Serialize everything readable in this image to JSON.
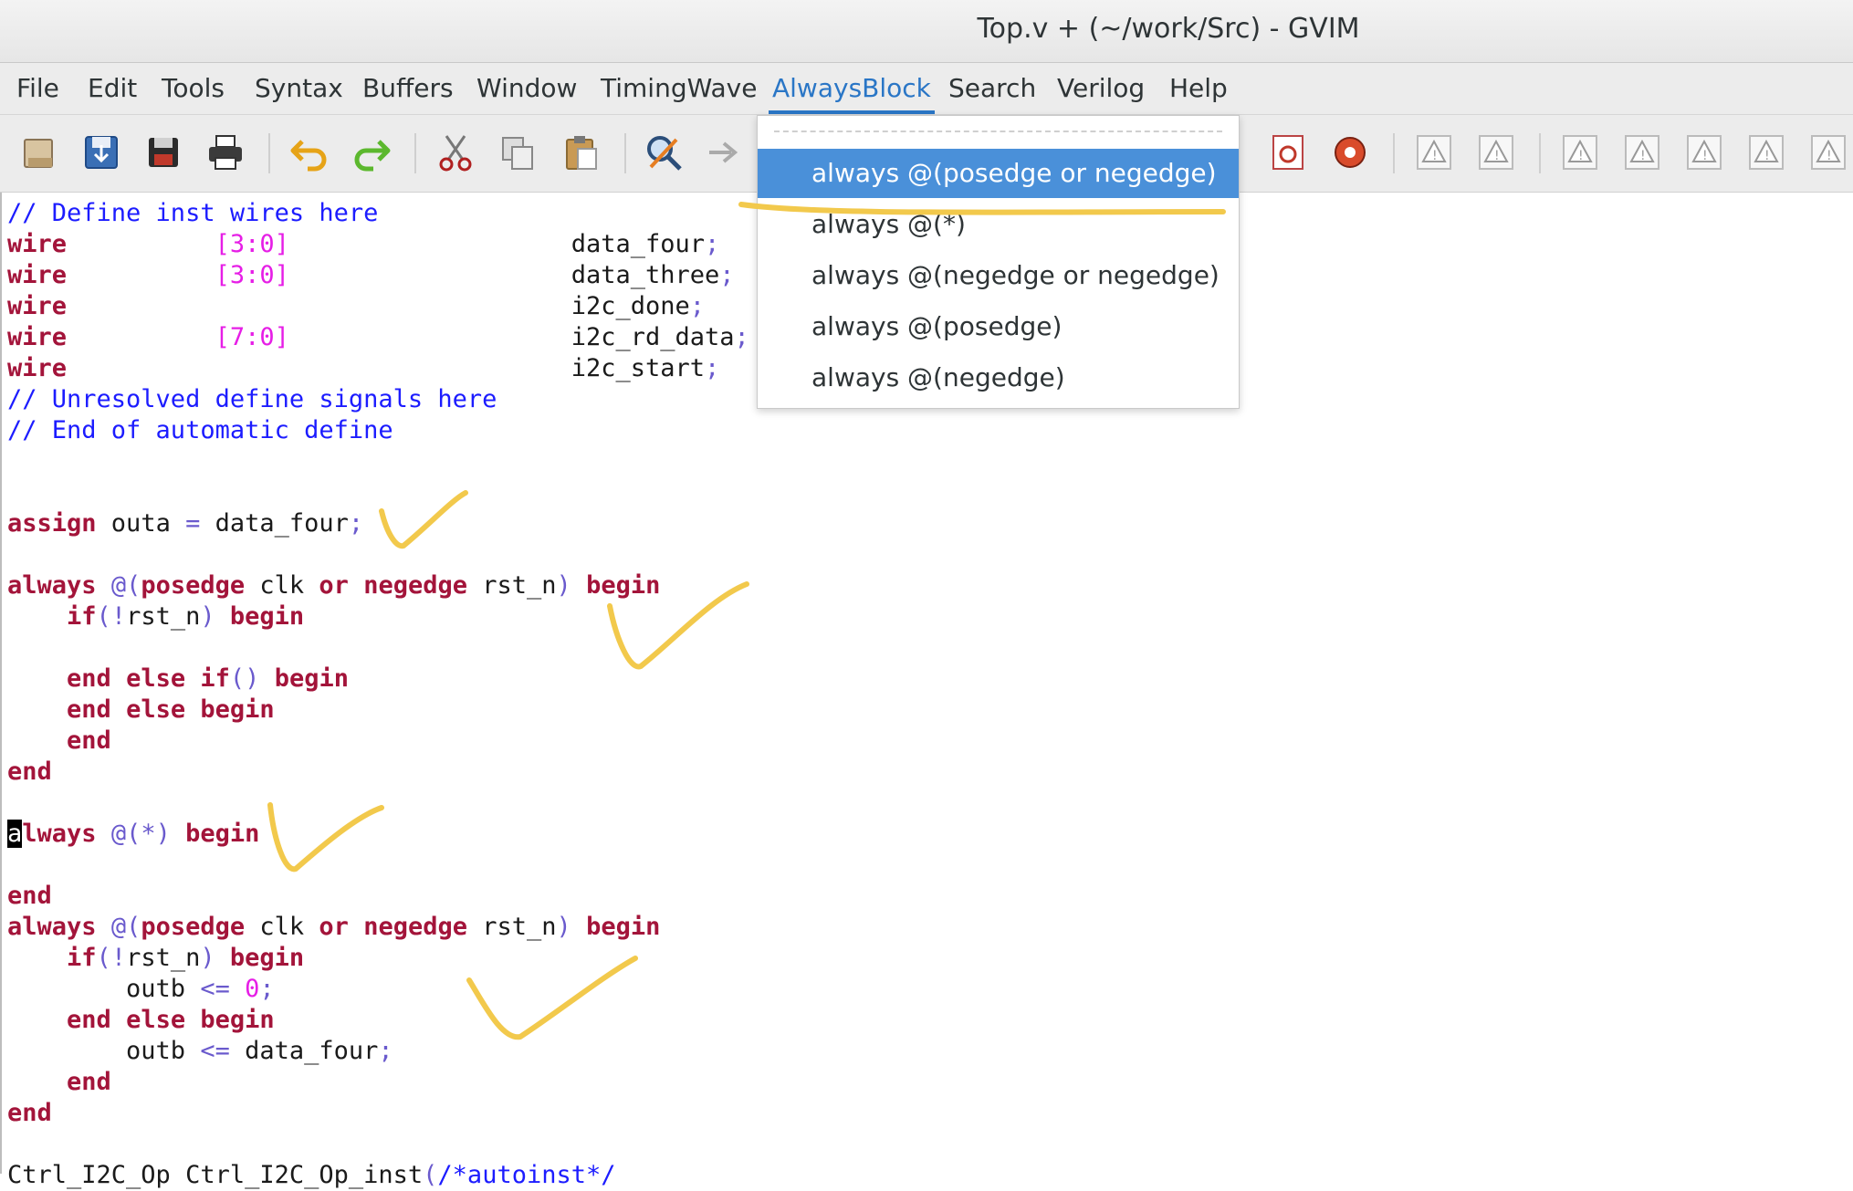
{
  "window": {
    "title": "Top.v + (~/work/Src) - GVIM"
  },
  "menubar": {
    "items": [
      "File",
      "Edit",
      "Tools",
      "Syntax",
      "Buffers",
      "Window",
      "TimingWave",
      "AlwaysBlock",
      "Search",
      "Verilog",
      "Help"
    ],
    "active": "AlwaysBlock"
  },
  "toolbar": {
    "icons": [
      "open-file-icon",
      "save-file-icon",
      "save-all-icon",
      "print-icon",
      "undo-icon",
      "redo-icon",
      "cut-icon",
      "copy-icon",
      "paste-icon",
      "find-replace-icon",
      "find-next-icon",
      "make-icon",
      "run-ctags-icon",
      "tool-warning-icon"
    ]
  },
  "dropdown": {
    "items": [
      "always @(posedge or negedge)",
      "always @(*)",
      "always @(negedge or negedge)",
      "always @(posedge)",
      "always @(negedge)"
    ],
    "selected_index": 0
  },
  "editor": {
    "lines": [
      "// Define inst wires here",
      "wire          [3:0]                   data_four;",
      "wire          [3:0]                   data_three;",
      "wire                                  i2c_done;",
      "wire          [7:0]                   i2c_rd_data;",
      "wire                                  i2c_start;",
      "// Unresolved define signals here",
      "// End of automatic define",
      "",
      "",
      "assign outa = data_four;",
      "",
      "always @(posedge clk or negedge rst_n) begin",
      "    if(!rst_n) begin",
      "",
      "    end else if() begin",
      "    end else begin",
      "    end",
      "end",
      "",
      "always @(*) begin",
      "",
      "end",
      "always @(posedge clk or negedge rst_n) begin",
      "    if(!rst_n) begin",
      "        outb <= 0;",
      "    end else begin",
      "        outb <= data_four;",
      "    end",
      "end",
      "",
      "Ctrl_I2C_Op Ctrl_I2C_Op_inst(/*autoinst*/"
    ]
  },
  "colors": {
    "comment": "#1c1cff",
    "keyword": "#a3143a",
    "number": "#e61ee6",
    "punct": "#6a5acd",
    "menu_active": "#2a76c6",
    "selection": "#4a90d9",
    "annotation": "#f2c94c"
  }
}
